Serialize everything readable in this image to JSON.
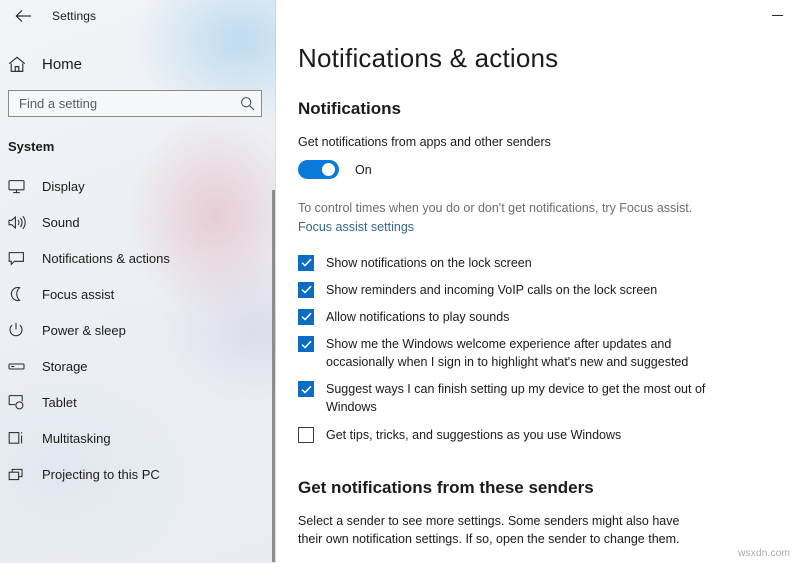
{
  "window": {
    "app_title": "Settings",
    "back_icon": "back-arrow-icon",
    "minimize_label": "Minimize"
  },
  "sidebar": {
    "home": {
      "label": "Home",
      "icon": "home-icon"
    },
    "search": {
      "placeholder": "Find a setting",
      "value": "",
      "icon": "search-icon"
    },
    "section_title": "System",
    "items": [
      {
        "label": "Display",
        "icon": "monitor-icon",
        "selected": false
      },
      {
        "label": "Sound",
        "icon": "speaker-icon",
        "selected": false
      },
      {
        "label": "Notifications & actions",
        "icon": "notification-balloon-icon",
        "selected": true
      },
      {
        "label": "Focus assist",
        "icon": "moon-icon",
        "selected": false
      },
      {
        "label": "Power & sleep",
        "icon": "power-icon",
        "selected": false
      },
      {
        "label": "Storage",
        "icon": "drive-icon",
        "selected": false
      },
      {
        "label": "Tablet",
        "icon": "tablet-icon",
        "selected": false
      },
      {
        "label": "Multitasking",
        "icon": "multitasking-icon",
        "selected": false
      },
      {
        "label": "Projecting to this PC",
        "icon": "project-screen-icon",
        "selected": false
      }
    ]
  },
  "main": {
    "page_title": "Notifications & actions",
    "notifications_heading": "Notifications",
    "master_toggle": {
      "label": "Get notifications from apps and other senders",
      "state_label": "On",
      "on": true
    },
    "focus_hint": "To control times when you do or don't get notifications, try Focus assist.",
    "focus_link": "Focus assist settings",
    "checkboxes": [
      {
        "label": "Show notifications on the lock screen",
        "checked": true
      },
      {
        "label": "Show reminders and incoming VoIP calls on the lock screen",
        "checked": true
      },
      {
        "label": "Allow notifications to play sounds",
        "checked": true
      },
      {
        "label": "Show me the Windows welcome experience after updates and occasionally when I sign in to highlight what's new and suggested",
        "checked": true
      },
      {
        "label": "Suggest ways I can finish setting up my device to get the most out of Windows",
        "checked": true
      },
      {
        "label": "Get tips, tricks, and suggestions as you use Windows",
        "checked": false
      }
    ],
    "senders_heading": "Get notifications from these senders",
    "senders_desc": "Select a sender to see more settings. Some senders might also have their own notification settings. If so, open the sender to change them."
  },
  "watermark": "wsxdn.com",
  "colors": {
    "accent": "#0a7ad8",
    "checkbox": "#0a6cc4",
    "link": "#39698a",
    "content_bg": "#ffffff",
    "sidebar_bg": "#eef1f5"
  }
}
